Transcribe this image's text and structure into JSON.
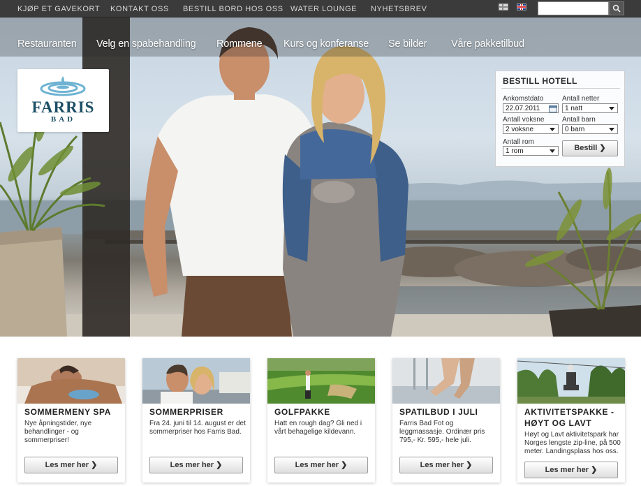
{
  "topbar": {
    "links": [
      "KJØP ET GAVEKORT",
      "KONTAKT OSS",
      "BESTILL BORD HOS OSS",
      "WATER LOUNGE",
      "NYHETSBREV"
    ],
    "search": {
      "value": "",
      "placeholder": ""
    }
  },
  "mainnav": {
    "items": [
      "Restauranten",
      "Velg en spabehandling",
      "Rommene",
      "Kurs og konferanse",
      "Se bilder",
      "Våre pakketilbud"
    ]
  },
  "logo": {
    "name": "FARRIS",
    "sub": "BAD"
  },
  "booking": {
    "title": "BESTILL HOTELL",
    "arrival_label": "Ankomstdato",
    "arrival_value": "22.07.2011",
    "nights_label": "Antall netter",
    "nights_value": "1 natt",
    "adults_label": "Antall voksne",
    "adults_value": "2 voksne",
    "children_label": "Antall barn",
    "children_value": "0 barn",
    "rooms_label": "Antall rom",
    "rooms_value": "1 rom",
    "submit_label": "Bestill ❯"
  },
  "cards": [
    {
      "title": "SOMMERMENY SPA",
      "text": "Nye åpningstider, nye behandlinger - og sommerpriser!",
      "button": "Les mer her ❯"
    },
    {
      "title": "SOMMERPRISER",
      "text": "Fra 24. juni til 14. august er det sommerpriser hos Farris Bad.",
      "button": "Les mer her ❯"
    },
    {
      "title": "GOLFPAKKE",
      "text": "Hatt en rough dag? Gli ned i vårt behagelige kildevann.",
      "button": "Les mer her ❯"
    },
    {
      "title": "SPATILBUD I JULI",
      "text": "Farris Bad Fot og leggmassasje. Ordinær pris 795,- Kr. 595,- hele juli.",
      "button": "Les mer her ❯"
    },
    {
      "title": "AKTIVITETSPAKKE - HØYT OG LAVT",
      "text": "Høyt og Lavt aktivitetspark har Norges lengste zip-line, på 500 meter. Landingsplass hos oss.",
      "button": "Les mer her ❯"
    }
  ],
  "colors": {
    "topbar": "#3b3b3b",
    "brand": "#1d4f66",
    "logo_accent": "#6fb3d2"
  }
}
